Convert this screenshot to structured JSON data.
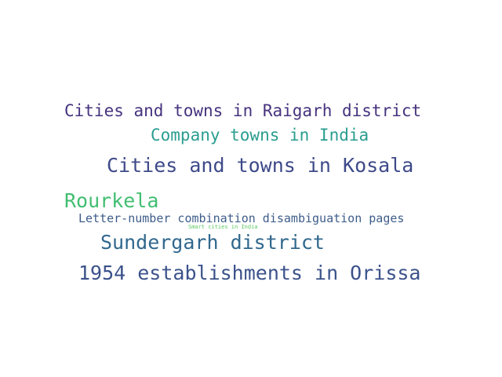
{
  "words": [
    {
      "text": "Cities and towns in Raigarh district",
      "color": "#46337e"
    },
    {
      "text": "Company towns in India",
      "color": "#2a9d8f"
    },
    {
      "text": "Cities and towns in Kosala",
      "color": "#3e4a89"
    },
    {
      "text": "Rourkela",
      "color": "#42be71"
    },
    {
      "text": "Letter-number combination disambiguation pages",
      "color": "#3e5c8a"
    },
    {
      "text": "Smart cities in India",
      "color": "#5ec962"
    },
    {
      "text": "Sundergarh district",
      "color": "#31688e"
    },
    {
      "text": "1954 establishments in Orissa",
      "color": "#3b528b"
    }
  ]
}
